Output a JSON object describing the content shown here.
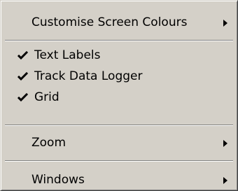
{
  "menu": {
    "items": [
      {
        "label": "Customise Screen Colours",
        "has_submenu": true,
        "checked": false
      },
      {
        "label": "Text Labels",
        "has_submenu": false,
        "checked": true
      },
      {
        "label": "Track Data Logger",
        "has_submenu": false,
        "checked": true
      },
      {
        "label": "Grid",
        "has_submenu": false,
        "checked": true
      },
      {
        "label": "Zoom",
        "has_submenu": true,
        "checked": false
      },
      {
        "label": "Windows",
        "has_submenu": true,
        "checked": false
      }
    ],
    "icons": {
      "check": "checkmark-icon",
      "submenu": "submenu-arrow-icon"
    }
  }
}
